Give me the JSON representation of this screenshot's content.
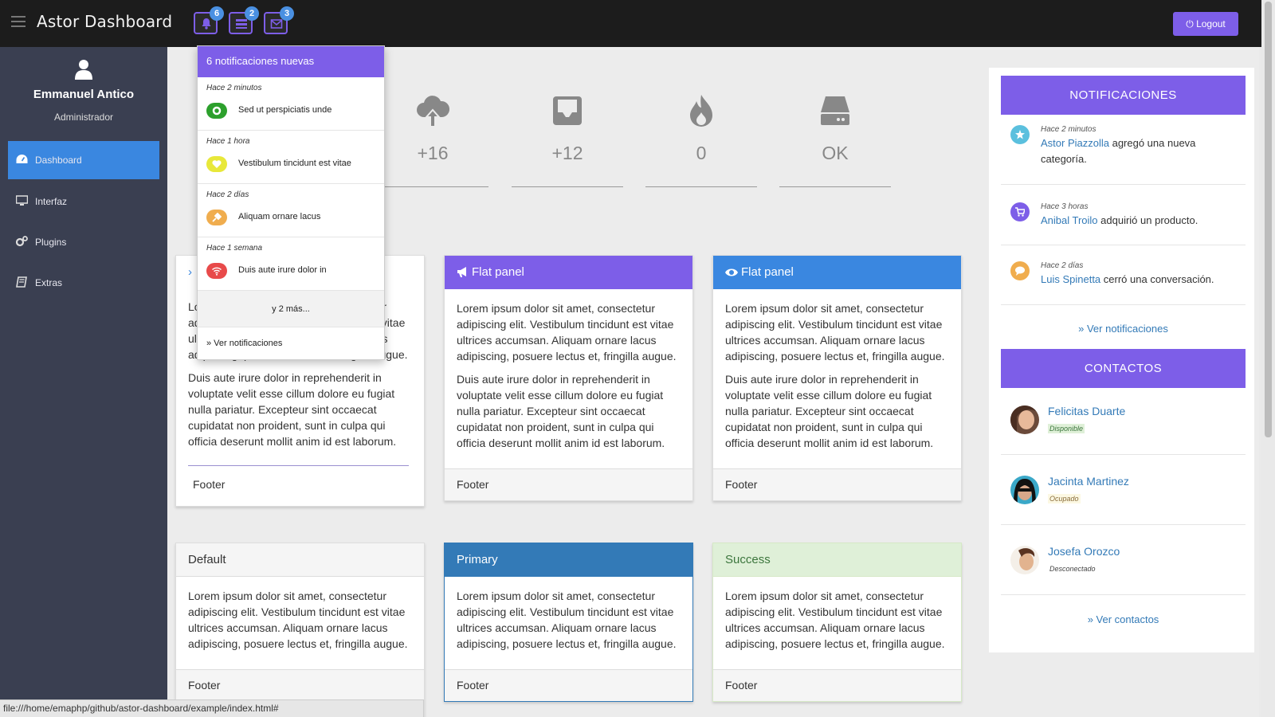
{
  "app": {
    "title": "Astor Dashboard",
    "logout_label": "Logout"
  },
  "top_badges": {
    "notifications": "6",
    "tasks": "2",
    "messages": "3"
  },
  "user": {
    "name": "Emmanuel Antico",
    "role": "Administrador"
  },
  "sidebar": {
    "items": [
      {
        "label": "Dashboard",
        "icon": "dashboard-icon"
      },
      {
        "label": "Interfaz",
        "icon": "monitor-icon"
      },
      {
        "label": "Plugins",
        "icon": "cogs-icon"
      },
      {
        "label": "Extras",
        "icon": "book-icon"
      }
    ]
  },
  "stats": [
    {
      "icon": "cloud-upload-icon",
      "value": "+16"
    },
    {
      "icon": "inbox-icon",
      "value": "+12"
    },
    {
      "icon": "fire-icon",
      "value": "0"
    },
    {
      "icon": "server-icon",
      "value": "OK"
    }
  ],
  "lorem": {
    "p1": "Lorem ipsum dolor sit amet, consectetur adipiscing elit. Vestibulum tincidunt est vitae ultrices accumsan. Aliquam ornare lacus adipiscing, posuere lectus et, fringilla augue.",
    "p2": "Duis aute irure dolor in reprehenderit in voluptate velit esse cillum dolore eu fugiat nulla pariatur. Excepteur sint occaecat cupidatat non proident, sunt in culpa qui officia deserunt mollit anim id est laborum."
  },
  "panels": {
    "flat_title": "Flat panel",
    "footer": "Footer",
    "default_title": "Default",
    "primary_title": "Primary",
    "success_title": "Success"
  },
  "notifications_panel": {
    "title": "NOTIFICACIONES",
    "items": [
      {
        "time": "Hace 2 minutos",
        "who": "Astor Piazzolla",
        "text": " agregó una nueva categoría.",
        "color": "#5bc0de",
        "icon": "star-icon"
      },
      {
        "time": "Hace 3 horas",
        "who": "Anibal Troilo",
        "text": " adquirió un producto.",
        "color": "#7d5ee8",
        "icon": "cart-icon"
      },
      {
        "time": "Hace 2 días",
        "who": "Luis Spinetta",
        "text": " cerró una conversación.",
        "color": "#f0ad4e",
        "icon": "comment-icon"
      }
    ],
    "link": "» Ver notificaciones"
  },
  "contacts_panel": {
    "title": "CONTACTOS",
    "items": [
      {
        "name": "Felicitas Duarte",
        "status": "Disponible"
      },
      {
        "name": "Jacinta Martinez",
        "status": "Ocupado"
      },
      {
        "name": "Josefa Orozco",
        "status": "Desconectado"
      }
    ],
    "link": "» Ver contactos"
  },
  "dropdown": {
    "header": "6 notificaciones nuevas",
    "items": [
      {
        "time": "Hace 2 minutos",
        "text": "Sed ut perspiciatis unde",
        "color": "#2ca02c",
        "icon": "cog-icon"
      },
      {
        "time": "Hace 1 hora",
        "text": "Vestibulum tincidunt est vitae",
        "color": "#e8e83a",
        "icon": "heart-icon"
      },
      {
        "time": "Hace 2 días",
        "text": "Aliquam ornare lacus",
        "color": "#f0ad4e",
        "icon": "plug-icon"
      },
      {
        "time": "Hace 1 semana",
        "text": "Duis aute irure dolor in",
        "color": "#e84a4a",
        "icon": "wifi-icon"
      }
    ],
    "more": "y 2 más...",
    "all": "» Ver notificaciones"
  },
  "statusbar": "file:///home/emaphp/github/astor-dashboard/example/index.html#"
}
